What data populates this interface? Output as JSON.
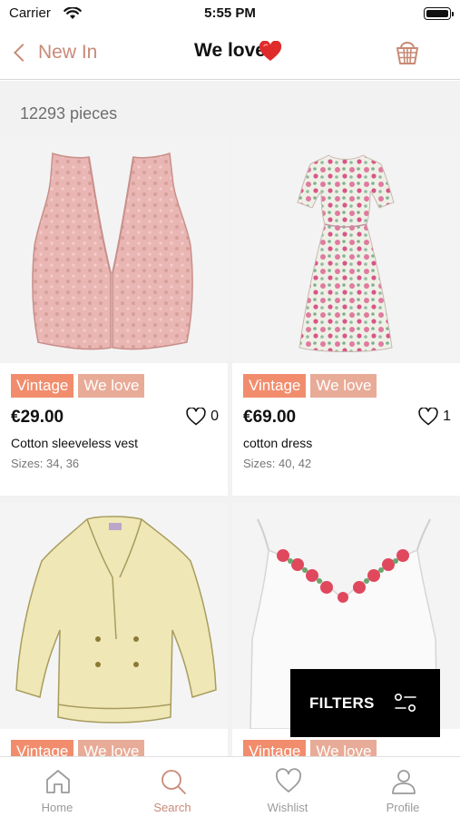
{
  "status_bar": {
    "carrier": "Carrier",
    "time": "5:55 PM"
  },
  "nav": {
    "back_label": "New In",
    "title": "We love"
  },
  "results": {
    "count_text": "12293 pieces"
  },
  "products": [
    {
      "tags": [
        "Vintage",
        "We love"
      ],
      "price": "€29.00",
      "likes": "0",
      "name": "Cotton sleeveless vest",
      "sizes": "Sizes: 34, 36"
    },
    {
      "tags": [
        "Vintage",
        "We love"
      ],
      "price": "€69.00",
      "likes": "1",
      "name": "cotton dress",
      "sizes": "Sizes: 40, 42"
    },
    {
      "tags": [
        "Vintage",
        "We love"
      ]
    },
    {
      "tags": [
        "Vintage",
        "We love"
      ]
    }
  ],
  "filters_button": {
    "label": "FILTERS"
  },
  "tabs": [
    {
      "label": "Home",
      "icon": "home-icon",
      "active": false
    },
    {
      "label": "Search",
      "icon": "search-icon",
      "active": true
    },
    {
      "label": "Wishlist",
      "icon": "heart-icon",
      "active": false
    },
    {
      "label": "Profile",
      "icon": "profile-icon",
      "active": false
    }
  ],
  "colors": {
    "accent": "#c88a77",
    "vintage_tag": "#f18d6d",
    "welove_tag": "#e8ab97",
    "background_grey": "#f2f2f2"
  }
}
